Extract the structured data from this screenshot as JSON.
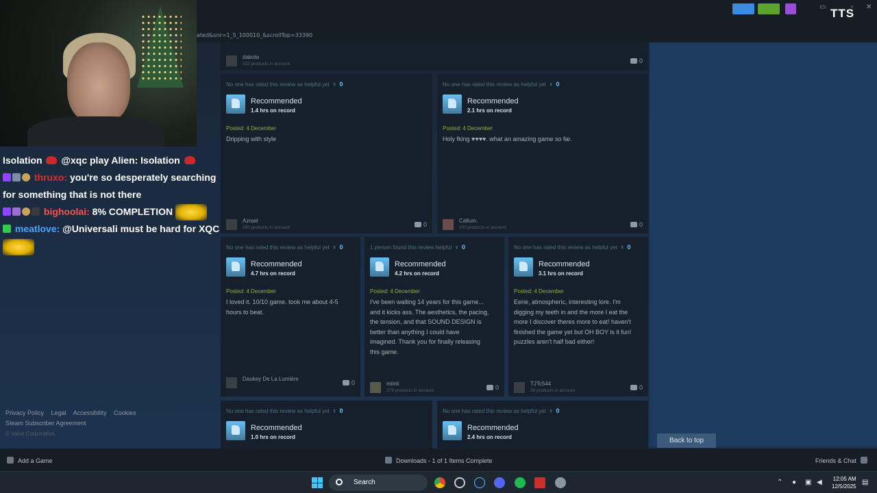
{
  "browser": {
    "url": "ated&snr=1_5_100010_&scrollTop=33390",
    "tts_label": "TTS"
  },
  "chat": {
    "lines": [
      {
        "pre": "Isolation",
        "user": "",
        "msg": "@xqc play Alien: Isolation"
      },
      {
        "user": "thruxo:",
        "msg": "you're so desperately searching"
      },
      {
        "cont": "for something that is not there"
      },
      {
        "user": "bighoolai:",
        "msg": "8% COMPLETION"
      },
      {
        "user": "meatlove:",
        "msg": "@Universali must be hard for XQC"
      }
    ]
  },
  "footer": {
    "links": [
      "Privacy Policy",
      "Legal",
      "Accessibility",
      "Cookies"
    ],
    "ssa": "Steam Subscriber Agreement",
    "copyright": "© Valve Corporation."
  },
  "top_card": {
    "author": "dakota",
    "products": "332 products in account",
    "comments": "0"
  },
  "reviews": [
    {
      "helpful": "No one has rated this review as helpful yet",
      "helpful_count": "0",
      "verdict": "Recommended",
      "hours": "1.4 hrs on record",
      "posted": "Posted: 4 December",
      "text": "Dripping with style",
      "author": "Azrael",
      "products": "290 products in account",
      "comments": "0"
    },
    {
      "helpful": "No one has rated this review as helpful yet",
      "helpful_count": "0",
      "verdict": "Recommended",
      "hours": "2.1 hrs on record",
      "posted": "Posted: 4 December",
      "text": "Holy fking ♥♥♥♥. what an amazing game so far.",
      "author": "Callum.",
      "products": "200 products in account",
      "comments": "0"
    },
    {
      "helpful": "No one has rated this review as helpful yet",
      "helpful_count": "0",
      "verdict": "Recommended",
      "hours": "4.7 hrs on record",
      "posted": "Posted: 4 December",
      "text": "I loved it. 10/10 game. took me about 4-5\nhours to beat.",
      "author": "Daukey De La Lumière",
      "products": "",
      "comments": "0"
    },
    {
      "helpful": "1 person found this review helpful",
      "helpful_count": "0",
      "verdict": "Recommended",
      "hours": "4.2 hrs on record",
      "posted": "Posted: 4 December",
      "text": "I've been waiting 14 years for this game...\nand it kicks ass. The aesthetics, the pacing,\nthe tension, and that SOUND DESIGN is\nbetter than anything I could have\nimagined. Thank you for finally releasing\nthis game.",
      "author": "miinti",
      "products": "379 products in account",
      "comments": "0"
    },
    {
      "helpful": "No one has rated this review as helpful yet",
      "helpful_count": "0",
      "verdict": "Recommended",
      "hours": "3.1 hrs on record",
      "posted": "Posted: 4 December",
      "text": "Eerie, atmospheric, interesting lore. I'm\ndigging my teeth in and the more I eat the\nmore I discover theres more to eat! haven't\nfinished the game yet but OH BOY is it fun!\npuzzles aren't half bad either!",
      "author": "TJTc544",
      "products": "36 products in account",
      "comments": "0"
    },
    {
      "helpful": "No one has rated this review as helpful yet",
      "helpful_count": "0",
      "verdict": "Recommended",
      "hours": "1.0 hrs on record"
    },
    {
      "helpful": "No one has rated this review as helpful yet",
      "helpful_count": "0",
      "verdict": "Recommended",
      "hours": "2.4 hrs on record"
    }
  ],
  "back_to_top": "Back to top",
  "steam_bar": {
    "add_game": "Add a Game",
    "downloads": "Downloads - 1 of 1 Items Complete",
    "friends": "Friends & Chat"
  },
  "taskbar": {
    "search": "Search",
    "time": "12:05 AM",
    "date": "12/5/2025"
  },
  "colors": {
    "accent_blue": "#67c1f5",
    "posted_green": "#8eb14a",
    "steam_bg": "#1b2838"
  }
}
